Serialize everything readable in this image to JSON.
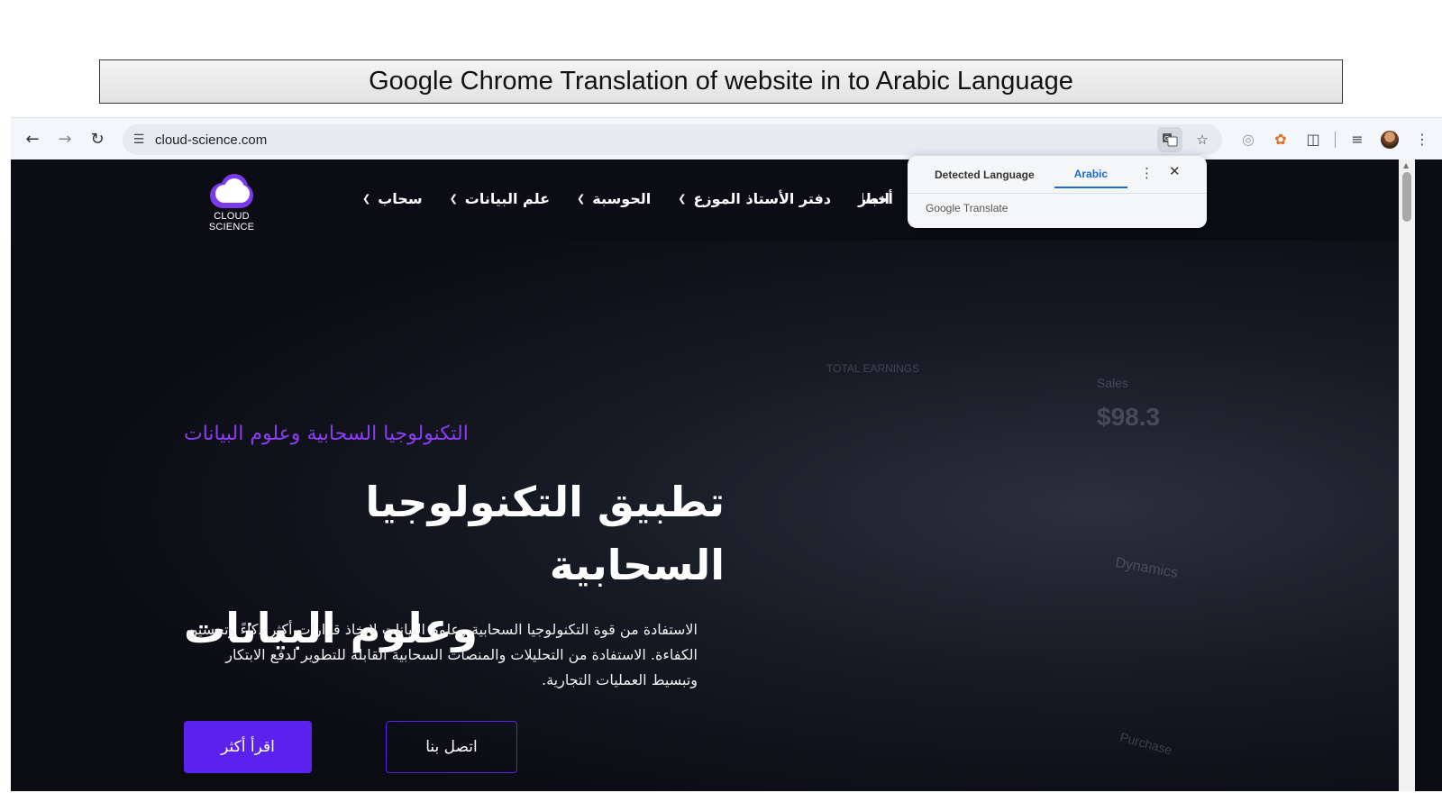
{
  "slide_caption": "Google Chrome Translation of website in to Arabic Language",
  "browser": {
    "url": "cloud-science.com",
    "icons": {
      "back": "back-arrow-icon",
      "forward": "forward-arrow-icon",
      "reload": "reload-icon",
      "site_info": "tune-icon",
      "translate": "translate-icon",
      "bookmark": "star-icon"
    }
  },
  "translate_popup": {
    "tabs": [
      "Detected Language",
      "Arabic"
    ],
    "active_tab": "Arabic",
    "footer": "Google Translate"
  },
  "site": {
    "logo_text": "CLOUD SCIENCE",
    "nav": [
      {
        "label": "سحاب"
      },
      {
        "label": "علم البيانات"
      },
      {
        "label": "الحوسبة"
      },
      {
        "label": "دفتر الأستاذ الموزع"
      },
      {
        "label": "أخبار"
      }
    ],
    "nav_partial": "اتصال",
    "hero": {
      "eyebrow": "التكنولوجيا السحابية وعلوم البيانات",
      "title_line1": "تطبيق التكنولوجيا السحابية",
      "title_line2": "وعلوم البيانات",
      "description": "الاستفادة من قوة التكنولوجيا السحابية وعلوم البيانات لاتخاذ قرارات أكثر ذكاءً وتحسين الكفاءة. الاستفادة من التحليلات والمنصات السحابية القابلة للتطوير لدفع الابتكار وتبسيط العمليات التجارية.",
      "primary_button": "اقرأ أكثر",
      "secondary_button": "اتصل بنا"
    },
    "background_texts": [
      "Sales",
      "$98.3",
      "Dynamics",
      "Purchase",
      "TOTAL EARNINGS"
    ]
  }
}
